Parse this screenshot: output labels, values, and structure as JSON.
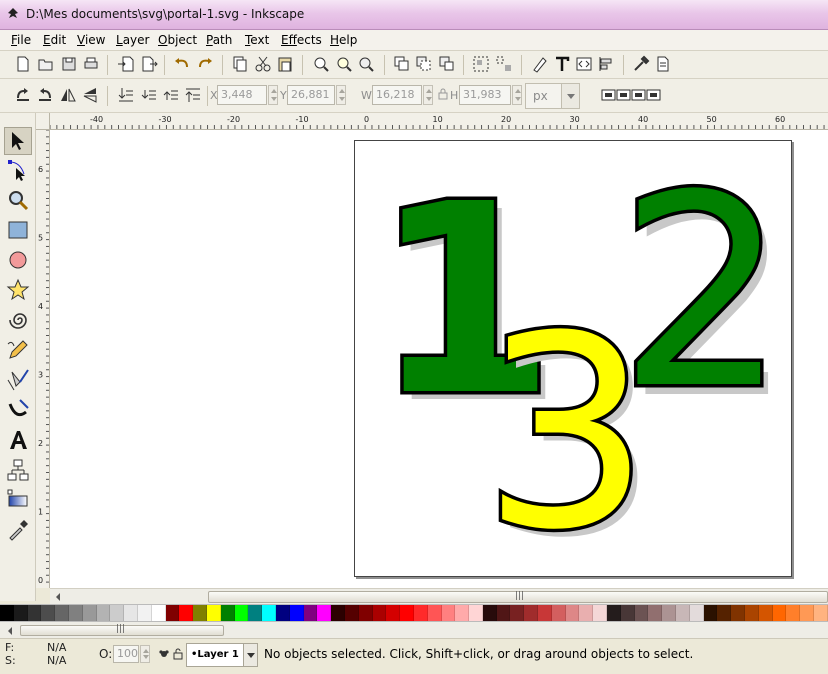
{
  "window": {
    "title": "D:\\Mes documents\\svg\\portal-1.svg - Inkscape",
    "title_bar_color": "#e3bde3"
  },
  "menu": [
    {
      "label": "File",
      "mnemonic": "F",
      "rest": "ile"
    },
    {
      "label": "Edit",
      "mnemonic": "E",
      "rest": "dit"
    },
    {
      "label": "View",
      "mnemonic": "V",
      "rest": "iew"
    },
    {
      "label": "Layer",
      "mnemonic": "L",
      "rest": "ayer"
    },
    {
      "label": "Object",
      "mnemonic": "O",
      "rest": "bject"
    },
    {
      "label": "Path",
      "mnemonic": "P",
      "rest": "ath"
    },
    {
      "label": "Text",
      "mnemonic": "T",
      "rest": "ext"
    },
    {
      "label": "Effects",
      "mnemonic": "Eff",
      "rest": "ects"
    },
    {
      "label": "Help",
      "mnemonic": "H",
      "rest": "elp"
    }
  ],
  "command_bar": {
    "icons": [
      "new-document-icon",
      "open-icon",
      "save-icon",
      "print-icon",
      "import-icon",
      "export-icon",
      "undo-icon",
      "redo-icon",
      "copy-icon",
      "cut-icon",
      "paste-icon",
      "zoom-selection-icon",
      "zoom-drawing-icon",
      "zoom-page-icon",
      "duplicate-icon",
      "clone-icon",
      "unlink-clone-icon",
      "group-icon",
      "ungroup-icon",
      "fill-stroke-icon",
      "text-font-icon",
      "xml-editor-icon",
      "align-icon",
      "preferences-icon",
      "document-properties-icon"
    ]
  },
  "selector_controls": {
    "x_label": "X",
    "x_value": "3,448",
    "y_label": "Y",
    "y_value": "26,881",
    "w_label": "W",
    "w_value": "16,218",
    "h_label": "H",
    "h_value": "31,983",
    "unit": "px"
  },
  "tools": [
    "selector-tool-icon",
    "node-tool-icon",
    "zoom-tool-icon",
    "rectangle-tool-icon",
    "ellipse-tool-icon",
    "star-tool-icon",
    "spiral-tool-icon",
    "pencil-tool-icon",
    "pen-tool-icon",
    "calligraphy-tool-icon",
    "text-tool-icon",
    "connector-tool-icon",
    "gradient-tool-icon",
    "dropper-tool-icon"
  ],
  "rulers": {
    "horizontal_labels": [
      "-40",
      "-30",
      "-20",
      "-10",
      "0",
      "10",
      "20",
      "30",
      "40",
      "50",
      "60"
    ],
    "vertical_labels": [
      "6",
      "5",
      "4",
      "3",
      "2",
      "1",
      "0"
    ]
  },
  "drawing": {
    "digit_one": "1",
    "digit_two": "2",
    "digit_three": "3",
    "green": "#008000",
    "yellow": "#ffff00",
    "outline": "#000000",
    "shadow": "#c8c8c8"
  },
  "palette": [
    "#000000",
    "#1a1a1a",
    "#333333",
    "#4d4d4d",
    "#666666",
    "#808080",
    "#999999",
    "#b3b3b3",
    "#cccccc",
    "#e6e6e6",
    "#f2f2f2",
    "#ffffff",
    "#800000",
    "#ff0000",
    "#808000",
    "#ffff00",
    "#008000",
    "#00ff00",
    "#008080",
    "#00ffff",
    "#000080",
    "#0000ff",
    "#800080",
    "#ff00ff",
    "#2b0000",
    "#550000",
    "#800000",
    "#aa0000",
    "#d40000",
    "#ff0000",
    "#ff2a2a",
    "#ff5555",
    "#ff8080",
    "#ffaaaa",
    "#ffd5d5",
    "#280b0b",
    "#501616",
    "#782121",
    "#a02c2c",
    "#c83737",
    "#d35f5f",
    "#de8787",
    "#e9afaf",
    "#f4d7d7",
    "#241c1c",
    "#483737",
    "#6c5353",
    "#916f6f",
    "#ac9393",
    "#c8b7b7",
    "#e3dbdb",
    "#2b1100",
    "#552200",
    "#803300",
    "#aa4400",
    "#d45500",
    "#ff6600",
    "#ff7f2a",
    "#ff9955",
    "#ffb380"
  ],
  "status": {
    "fill_label": "F:",
    "fill_value": "N/A",
    "stroke_label": "S:",
    "stroke_value": "N/A",
    "opacity_label": "O:",
    "opacity_value": "100",
    "layer": "•Layer 1",
    "message": "No objects selected. Click, Shift+click, or drag around objects to select."
  }
}
